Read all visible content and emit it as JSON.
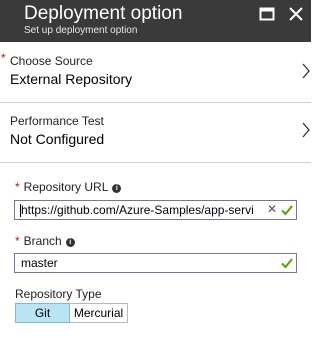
{
  "header": {
    "title": "Deployment option",
    "subtitle": "Set up deployment option"
  },
  "source": {
    "label": "Choose Source",
    "value": "External Repository"
  },
  "performance": {
    "label": "Performance Test",
    "value": "Not Configured"
  },
  "repository_url": {
    "label": "Repository URL",
    "value": "https://github.com/Azure-Samples/app-servi"
  },
  "branch": {
    "label": "Branch",
    "value": "master"
  },
  "repository_type": {
    "label": "Repository Type",
    "options": [
      "Git",
      "Mercurial"
    ],
    "selected": "Git"
  },
  "colors": {
    "header_bg": "#3a3a3a",
    "required": "#e00000",
    "valid": "#57a300",
    "input_border": "#7b6fb0",
    "selected_bg": "#b8e4f5"
  }
}
